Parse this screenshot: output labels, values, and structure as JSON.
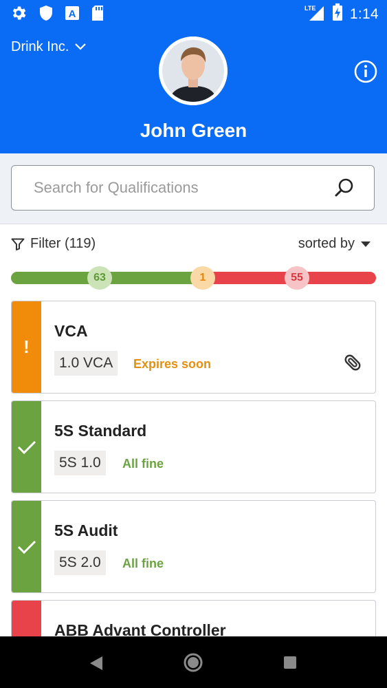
{
  "status_bar": {
    "time": "1:14",
    "network": "LTE",
    "icons": [
      "gear-icon",
      "shield-icon",
      "app-a-icon",
      "sd-card-icon",
      "signal-icon",
      "battery-charging-icon"
    ]
  },
  "header": {
    "company": "Drink Inc.",
    "user_name": "John Green"
  },
  "search": {
    "placeholder": "Search for Qualifications",
    "value": ""
  },
  "filter": {
    "label": "Filter (119)",
    "sort_label": "sorted by"
  },
  "summary": {
    "ok_count": "63",
    "warning_count": "1",
    "expired_count": "55",
    "ok_fraction": 0.53,
    "warning_fraction": 0.01,
    "expired_fraction": 0.46
  },
  "colors": {
    "header": "#0a6cf5",
    "ok": "#6aa33f",
    "warning": "#f08c0a",
    "expired": "#e8424a"
  },
  "qualifications": [
    {
      "title": "VCA",
      "tag": "1.0 VCA",
      "status": "Expires soon",
      "status_type": "warning",
      "marker": "!",
      "has_attachment": true
    },
    {
      "title": "5S Standard",
      "tag": "5S 1.0",
      "status": "All fine",
      "status_type": "ok",
      "marker": "check",
      "has_attachment": false
    },
    {
      "title": "5S Audit",
      "tag": "5S 2.0",
      "status": "All fine",
      "status_type": "ok",
      "marker": "check",
      "has_attachment": false
    },
    {
      "title": "ABB Advant Controller",
      "tag": "",
      "status": "",
      "status_type": "expired",
      "marker": "",
      "has_attachment": false
    }
  ]
}
